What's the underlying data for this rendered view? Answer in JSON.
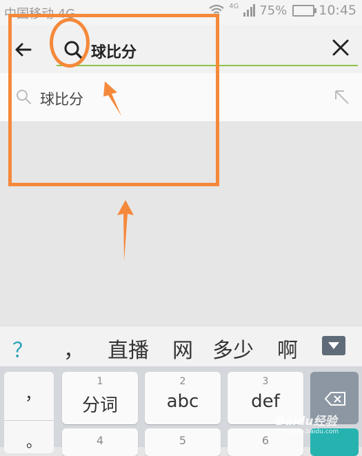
{
  "status_bar": {
    "carrier": "中国移动 4G",
    "network_tag": "4G",
    "battery": "75%",
    "time": "10:45"
  },
  "search": {
    "query": "球比分",
    "accent_color": "#8bc34a"
  },
  "suggestions": [
    {
      "text": "球比分"
    }
  ],
  "annotation_color": "#f5893b",
  "keyboard": {
    "candidates": [
      "？",
      "，",
      "直播",
      "网",
      "多少",
      "啊"
    ],
    "punctuation": [
      "，",
      "。"
    ],
    "keys": [
      {
        "num": "1",
        "label": "分词"
      },
      {
        "num": "2",
        "label": "abc"
      },
      {
        "num": "3",
        "label": "def"
      },
      {
        "num": "4",
        "label": ""
      },
      {
        "num": "5",
        "label": ""
      },
      {
        "num": "6",
        "label": ""
      }
    ],
    "accent_teal": "#26b3b0"
  },
  "watermark": {
    "brand": "Baidu经验",
    "url": "jingyan.baidu.com"
  }
}
